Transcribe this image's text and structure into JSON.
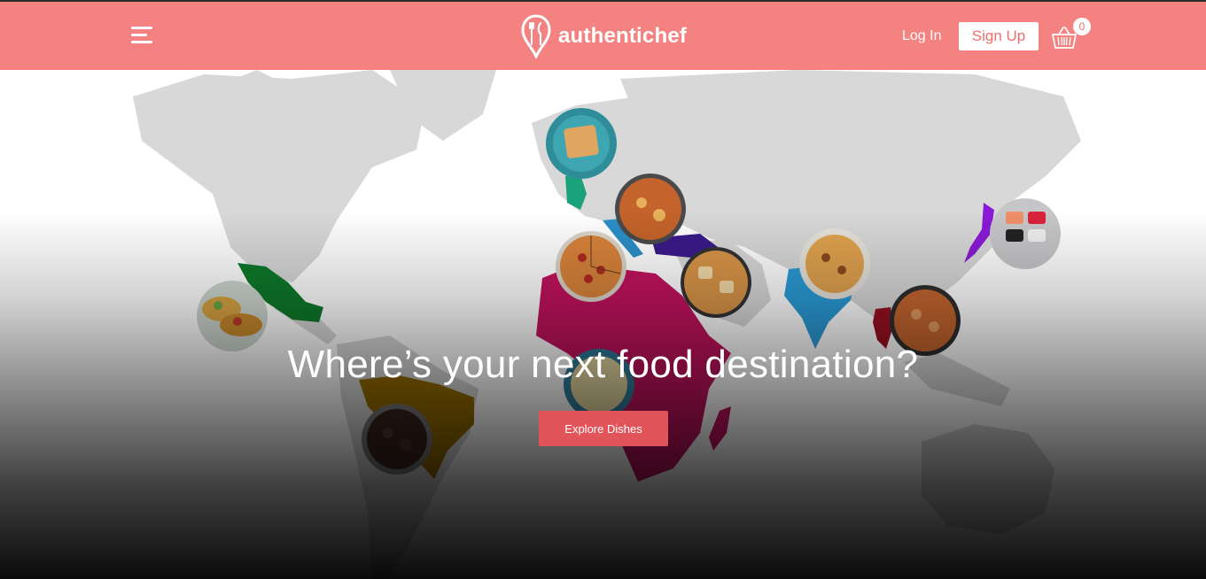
{
  "header": {
    "brand": "authentichef",
    "login_label": "Log In",
    "signup_label": "Sign Up",
    "cart_count": "0",
    "icons": [
      "menu-icon",
      "brand-pin-fork-knife-icon",
      "basket-icon"
    ]
  },
  "hero": {
    "headline": "Where’s your next food destination?",
    "cta_label": "Explore Dishes"
  },
  "colors": {
    "navbar": "#f38281",
    "cta": "#e0545a",
    "mexico": "#0e7a2a",
    "brazil": "#9a6f00",
    "africa": "#c2125e",
    "uk": "#1aa37a",
    "italy": "#2b8fc7",
    "turkey": "#3a1a8a",
    "india": "#2a9bd6",
    "thailand": "#9a1022",
    "japan": "#8a1ad6"
  },
  "dishes": [
    "tacos",
    "feijoada",
    "spanakopita",
    "lasagne",
    "pizza",
    "pide",
    "pasta",
    "biryani",
    "thai-curry",
    "sushi-box"
  ]
}
